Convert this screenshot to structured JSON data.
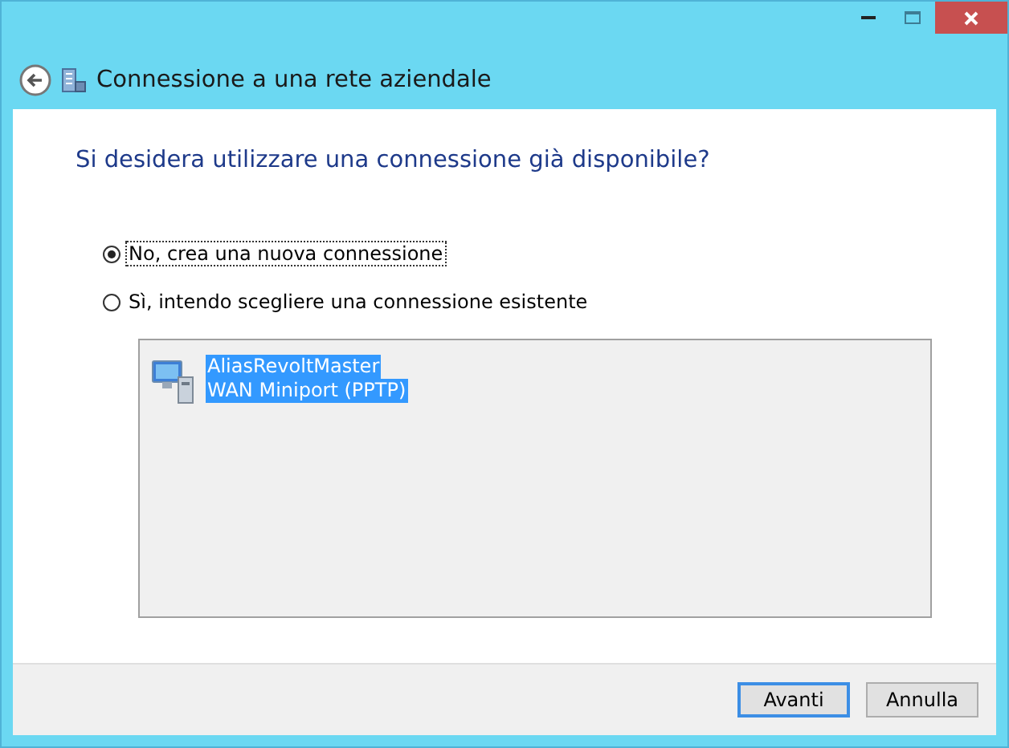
{
  "window": {
    "title": "Connessione a una rete aziendale"
  },
  "heading": "Si desidera utilizzare una connessione già disponibile?",
  "options": [
    {
      "label": "No, crea una nuova connessione",
      "selected": true,
      "focused": true
    },
    {
      "label": "Sì, intendo scegliere una connessione esistente",
      "selected": false,
      "focused": false
    }
  ],
  "connections": [
    {
      "name": "AliasRevoltMaster",
      "device": "WAN Miniport (PPTP)",
      "selected": true
    }
  ],
  "buttons": [
    {
      "label": "Avanti",
      "default": true
    },
    {
      "label": "Annulla",
      "default": false
    }
  ]
}
